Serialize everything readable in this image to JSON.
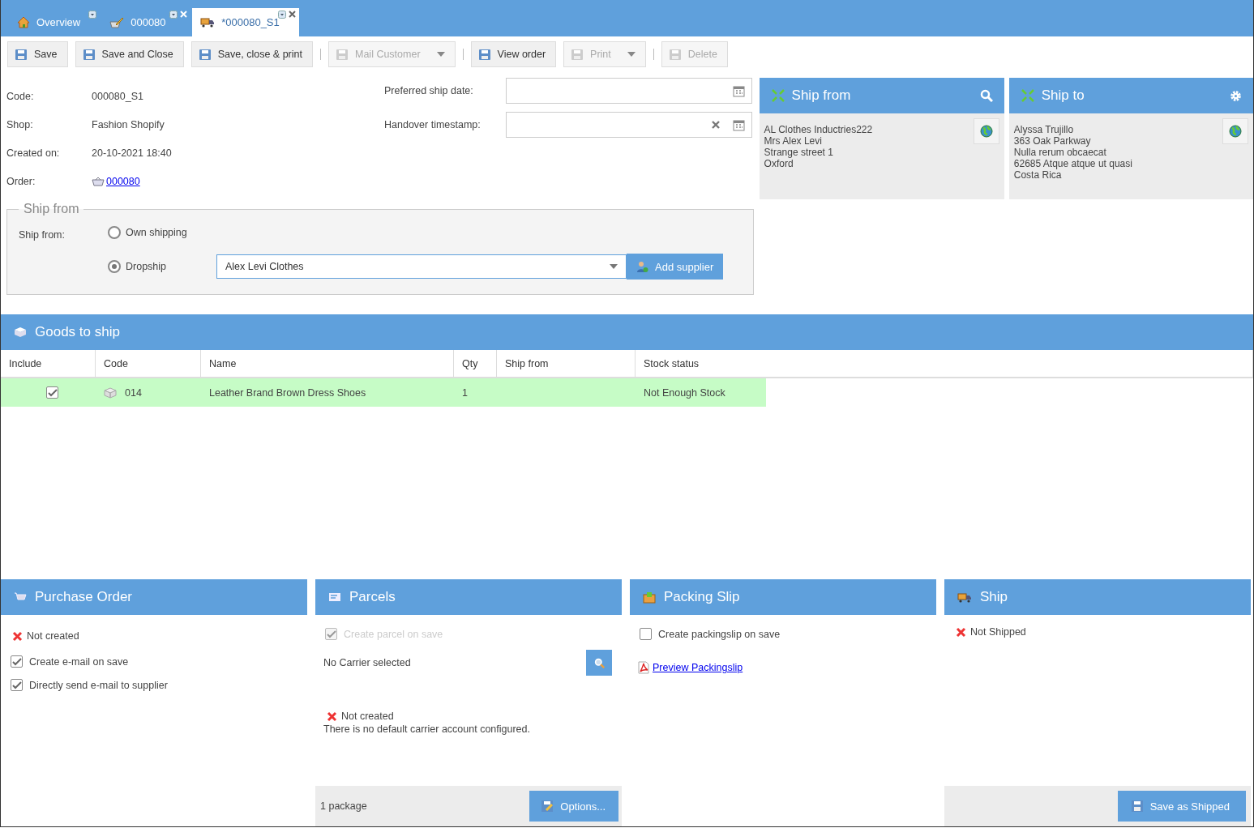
{
  "tabs": [
    {
      "label": "Overview",
      "selected": false,
      "closable": false
    },
    {
      "label": "000080",
      "selected": false,
      "closable": true
    },
    {
      "label": "*000080_S1",
      "selected": true,
      "closable": true
    }
  ],
  "toolbar": {
    "groups": [
      {
        "buttons": [
          {
            "label": "Save",
            "disabled": false,
            "dropdown": false
          },
          {
            "label": "Save and Close",
            "disabled": false,
            "dropdown": false
          },
          {
            "label": "Save, close & print",
            "disabled": false,
            "dropdown": false
          }
        ]
      },
      {
        "buttons": [
          {
            "label": "Mail Customer",
            "disabled": true,
            "dropdown": true
          }
        ]
      },
      {
        "buttons": [
          {
            "label": "View order",
            "disabled": false,
            "dropdown": false
          },
          {
            "label": "Print",
            "disabled": true,
            "dropdown": true
          }
        ]
      },
      {
        "buttons": [
          {
            "label": "Delete",
            "disabled": true,
            "dropdown": false
          }
        ]
      }
    ]
  },
  "details": [
    {
      "label": "Code:",
      "value": "000080_S1",
      "kind": "text"
    },
    {
      "label": "Shop:",
      "value": "Fashion Shopify",
      "kind": "text"
    },
    {
      "label": "Created on:",
      "value": "20-10-2021 18:40",
      "kind": "text"
    },
    {
      "label": "Order:",
      "value": "000080",
      "kind": "link"
    }
  ],
  "date_fields": [
    {
      "label": "Preferred ship date:",
      "clearable": false
    },
    {
      "label": "Handover timestamp:",
      "clearable": true
    }
  ],
  "ship_from_group": {
    "legend": "Ship from",
    "label": "Ship from:",
    "options": [
      {
        "label": "Own shipping",
        "selected": false
      },
      {
        "label": "Dropship",
        "selected": true
      }
    ],
    "supplier": "Alex Levi Clothes",
    "add_button": "Add supplier"
  },
  "address_cards": [
    {
      "title": "Ship from",
      "lines": [
        "AL Clothes Inductries222",
        "Mrs Alex Levi",
        "Strange street 1",
        "Oxford"
      ]
    },
    {
      "title": "Ship to",
      "lines": [
        "Alyssa Trujillo",
        "363 Oak Parkway",
        "Nulla rerum obcaecat",
        "62685 Atque atque ut quasi",
        "Costa Rica"
      ]
    }
  ],
  "goods": {
    "title": "Goods to ship",
    "columns": [
      "Include",
      "Code",
      "Name",
      "Qty",
      "Ship from",
      "Stock status"
    ],
    "rows": [
      {
        "included": true,
        "code": "014",
        "name": "Leather Brand Brown Dress Shoes",
        "qty": "1",
        "stock_status": "Not Enough Stock",
        "color": "#c6fcc6"
      }
    ]
  },
  "purchase_order": {
    "title": "Purchase Order",
    "status": "Not created",
    "checkboxes": [
      {
        "label": "Create e-mail on save",
        "checked": true,
        "disabled": false
      },
      {
        "label": "Directly send e-mail to supplier",
        "checked": true,
        "disabled": false
      }
    ]
  },
  "parcels": {
    "title": "Parcels",
    "checkbox": {
      "label": "Create parcel on save",
      "checked": true,
      "disabled": true
    },
    "carrier": "No Carrier selected",
    "status": "Not created",
    "note": "There is no default carrier account configured.",
    "footer_text": "1 package",
    "footer_button": "Options..."
  },
  "packing_slip": {
    "title": "Packing Slip",
    "checkbox": {
      "label": "Create packingslip on save",
      "checked": false,
      "disabled": false
    },
    "link": "Preview Packingslip"
  },
  "ship": {
    "title": "Ship",
    "status": "Not Shipped",
    "footer_button": "Save as Shipped"
  }
}
